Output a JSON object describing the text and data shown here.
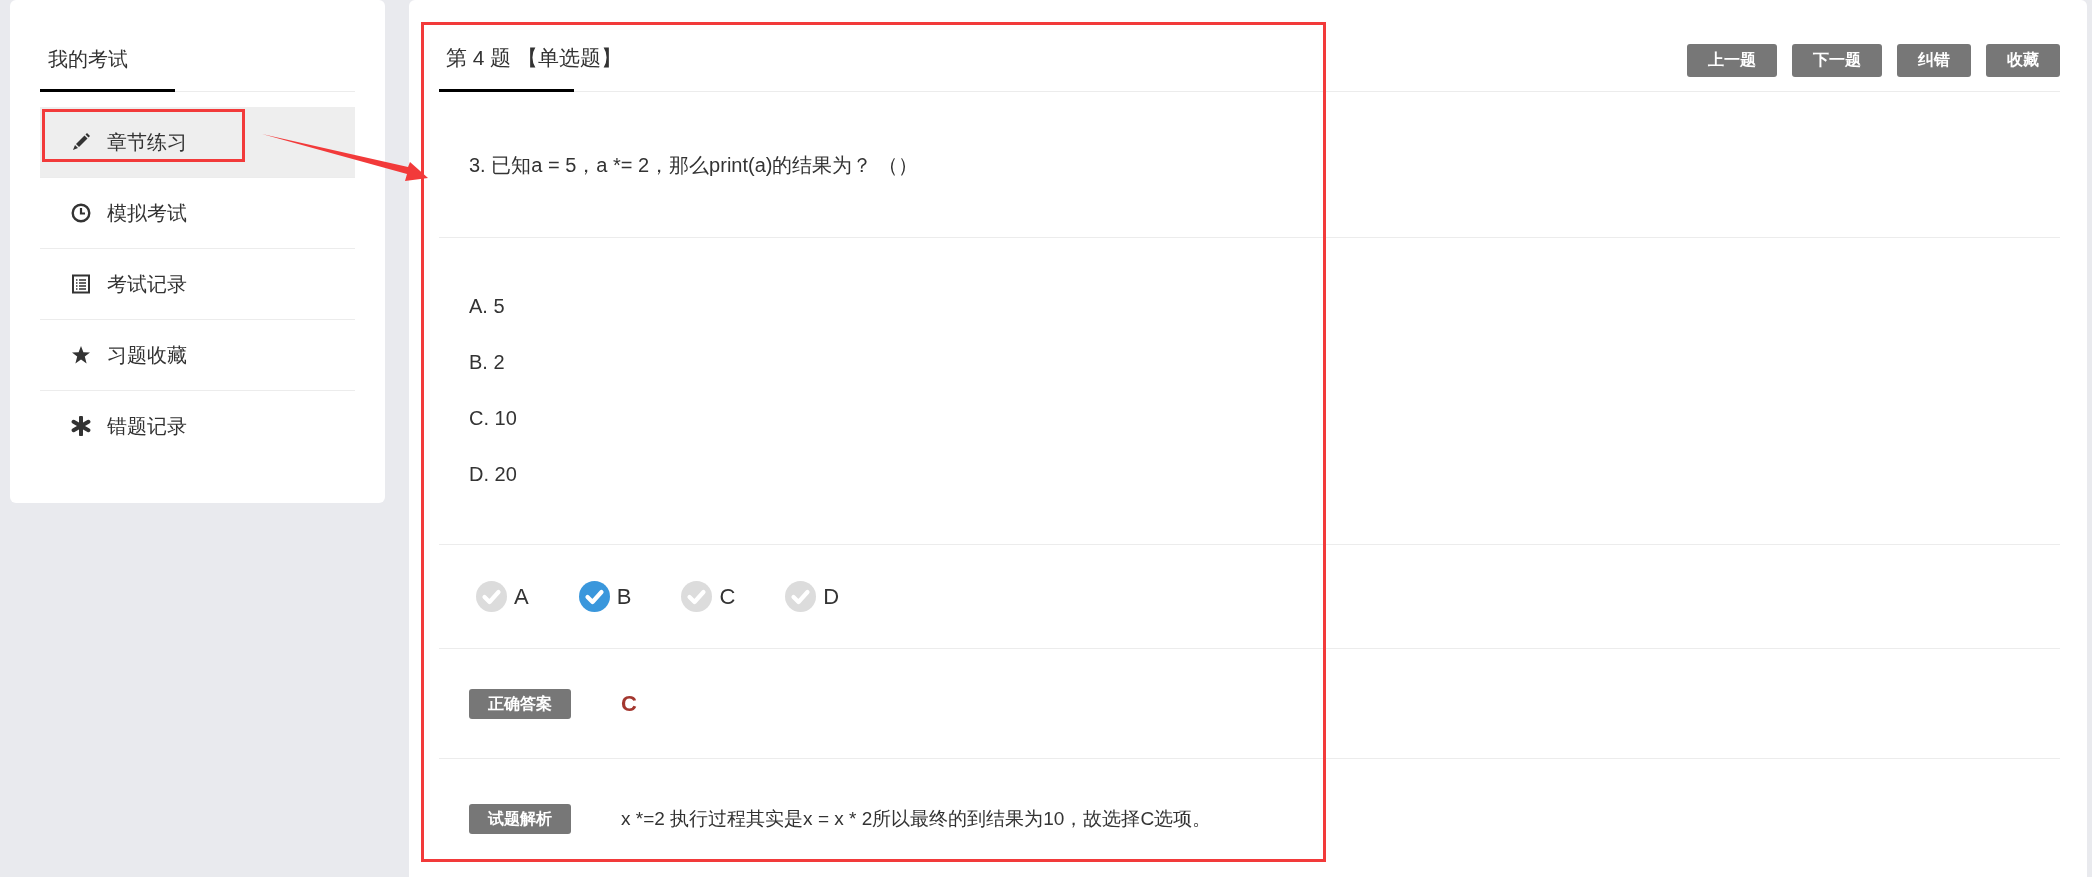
{
  "sidebar": {
    "title": "我的考试",
    "items": [
      {
        "label": "章节练习",
        "selected": true
      },
      {
        "label": "模拟考试",
        "selected": false
      },
      {
        "label": "考试记录",
        "selected": false
      },
      {
        "label": "习题收藏",
        "selected": false
      },
      {
        "label": "错题记录",
        "selected": false
      }
    ]
  },
  "question": {
    "tab": "第 4 题 【单选题】",
    "buttons": [
      "上一题",
      "下一题",
      "纠错",
      "收藏"
    ],
    "stem": "3. 已知a = 5，a *= 2，那么print(a)的结果为？ （）",
    "options": [
      "A. 5",
      "B. 2",
      "C. 10",
      "D. 20"
    ],
    "choices": [
      {
        "label": "A",
        "selected": false
      },
      {
        "label": "B",
        "selected": true
      },
      {
        "label": "C",
        "selected": false
      },
      {
        "label": "D",
        "selected": false
      }
    ],
    "answer": {
      "badge": "正确答案",
      "value": "C"
    },
    "analysis": {
      "badge": "试题解析",
      "text": "x *=2 执行过程其实是x = x * 2所以最终的到结果为10，故选择C选项。"
    }
  }
}
